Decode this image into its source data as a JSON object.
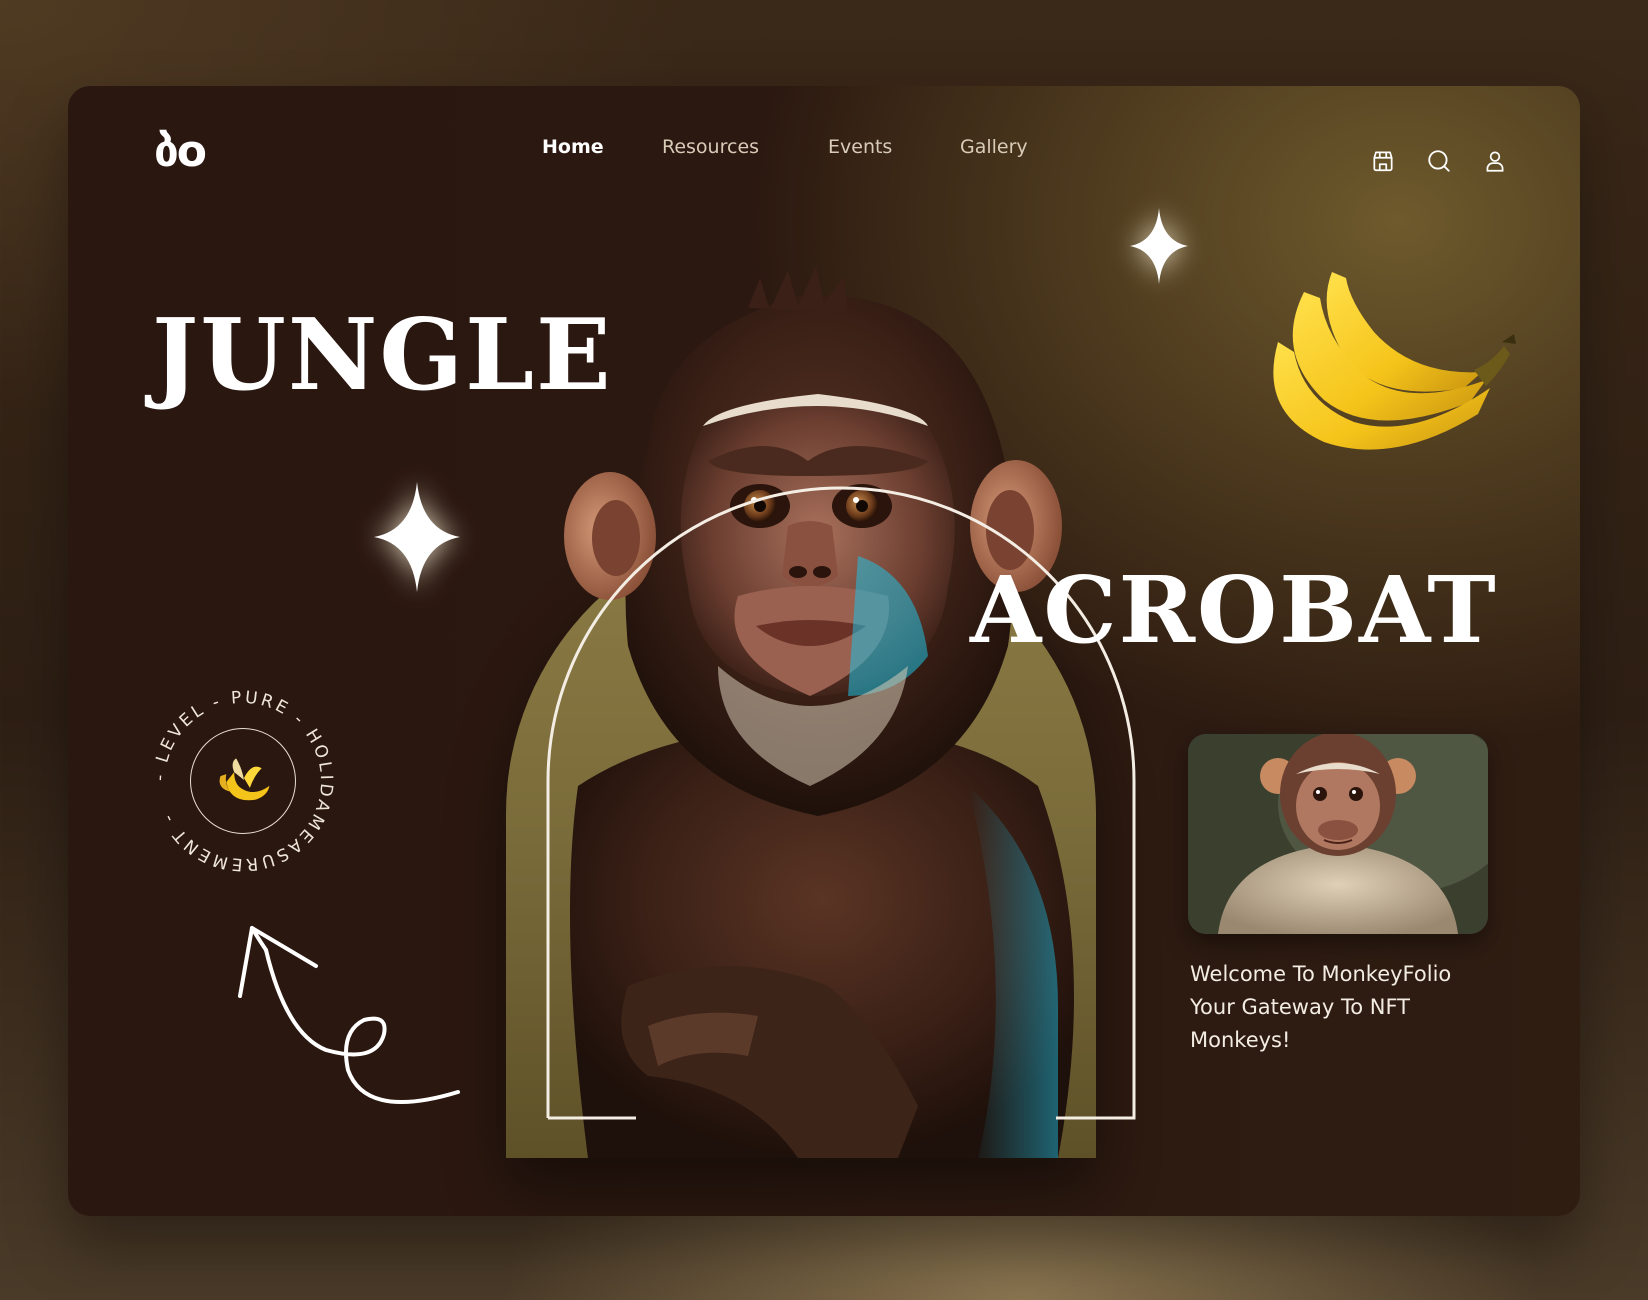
{
  "brand": {
    "logo": "ბo"
  },
  "nav": {
    "items": [
      {
        "label": "Home",
        "active": true
      },
      {
        "label": "Resources",
        "active": false
      },
      {
        "label": "Events",
        "active": false
      },
      {
        "label": "Gallery",
        "active": false
      }
    ]
  },
  "header_icons": [
    "store-icon",
    "search-icon",
    "user-icon"
  ],
  "hero": {
    "title_line1": "JUNGLE",
    "title_line2": "ACROBAT"
  },
  "badge": {
    "ring_text": "- LEVEL - PURE - HOLIDAMEASUREMENT -",
    "center_icon": "banana-emoji"
  },
  "welcome": {
    "text": "Welcome To MonkeyFolio\nYour Gateway To  NFT\nMonkeys!"
  },
  "colors": {
    "background": "#2b1810",
    "accent_gold": "#8c7c45",
    "text_light": "#ffffff",
    "nav_inactive": "#d8cbb8"
  }
}
